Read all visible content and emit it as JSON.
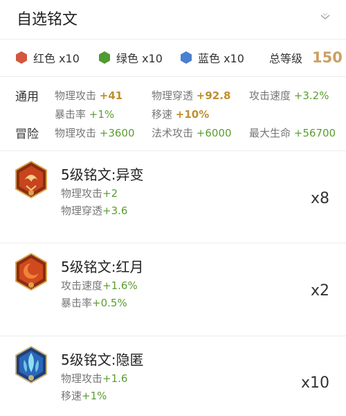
{
  "header": {
    "title": "自选铭文"
  },
  "colors": [
    {
      "label": "红色 x10",
      "color": "#d2573f"
    },
    {
      "label": "绿色 x10",
      "color": "#4f9a31"
    },
    {
      "label": "蓝色 x10",
      "color": "#4b7fd0"
    }
  ],
  "total": {
    "label": "总等级",
    "value": "150"
  },
  "stats": {
    "general_label": "通用",
    "adventure_label": "冒险",
    "general": [
      {
        "name": "物理攻击",
        "value": "+41"
      },
      {
        "name": "物理穿透",
        "value": "+92.8"
      },
      {
        "name": "攻击速度",
        "value": "+3.2%"
      },
      {
        "name": "暴击率",
        "value": "+1%"
      },
      {
        "name": "移速",
        "value": "+10%"
      }
    ],
    "adventure": [
      {
        "name": "物理攻击",
        "value": "+3600"
      },
      {
        "name": "法术攻击",
        "value": "+6000"
      },
      {
        "name": "最大生命",
        "value": "+56700"
      }
    ]
  },
  "runes": [
    {
      "name": "5级铭文:异变",
      "attrs": [
        {
          "name": "物理攻击",
          "value": "+2"
        },
        {
          "name": "物理穿透",
          "value": "+3.6"
        }
      ],
      "qty": "x8",
      "icon": "red-rune-icon"
    },
    {
      "name": "5级铭文:红月",
      "attrs": [
        {
          "name": "攻击速度",
          "value": "+1.6%"
        },
        {
          "name": "暴击率",
          "value": "+0.5%"
        }
      ],
      "qty": "x2",
      "icon": "red-moon-rune-icon"
    },
    {
      "name": "5级铭文:隐匿",
      "attrs": [
        {
          "name": "物理攻击",
          "value": "+1.6"
        },
        {
          "name": "移速",
          "value": "+1%"
        }
      ],
      "qty": "x10",
      "icon": "blue-rune-icon"
    }
  ]
}
